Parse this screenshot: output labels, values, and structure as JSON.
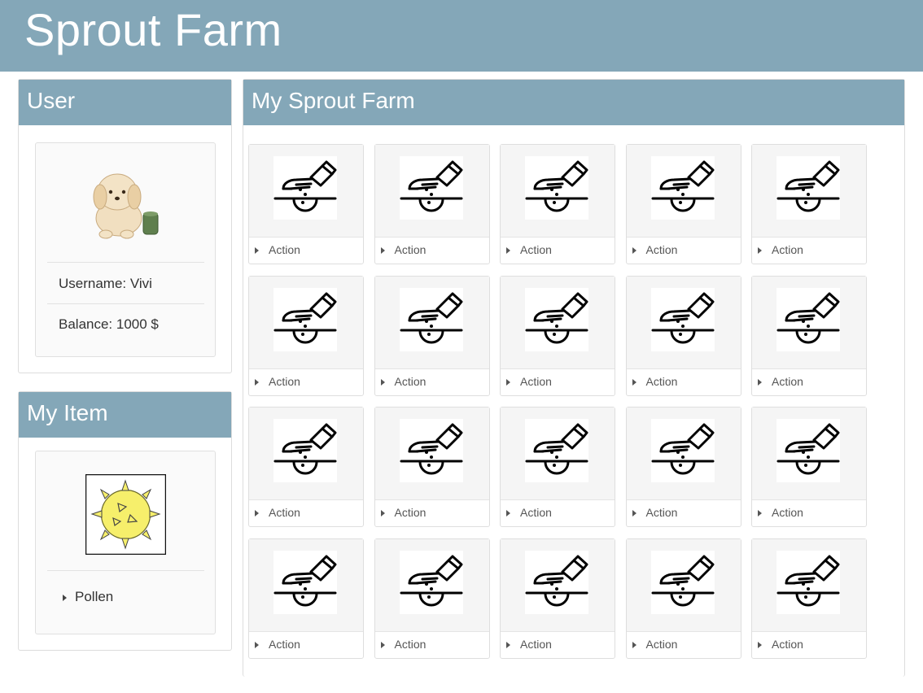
{
  "app": {
    "title": "Sprout Farm"
  },
  "user_panel": {
    "title": "User",
    "avatar_icon": "puppy-with-cup-avatar",
    "username_line": "Username: Vivi",
    "balance_line": "Balance: 1000 $"
  },
  "item_panel": {
    "title": "My Item",
    "item_icon": "pollen-icon",
    "item_name": "Pollen"
  },
  "farm_panel": {
    "title": "My Sprout Farm",
    "plot_icon": "planting-seed-icon",
    "plots": [
      {
        "action": "Action"
      },
      {
        "action": "Action"
      },
      {
        "action": "Action"
      },
      {
        "action": "Action"
      },
      {
        "action": "Action"
      },
      {
        "action": "Action"
      },
      {
        "action": "Action"
      },
      {
        "action": "Action"
      },
      {
        "action": "Action"
      },
      {
        "action": "Action"
      },
      {
        "action": "Action"
      },
      {
        "action": "Action"
      },
      {
        "action": "Action"
      },
      {
        "action": "Action"
      },
      {
        "action": "Action"
      },
      {
        "action": "Action"
      },
      {
        "action": "Action"
      },
      {
        "action": "Action"
      },
      {
        "action": "Action"
      },
      {
        "action": "Action"
      }
    ]
  },
  "colors": {
    "header_bg": "#84a7b8",
    "header_text": "#ffffff",
    "pollen_fill": "#f6ef6b"
  }
}
